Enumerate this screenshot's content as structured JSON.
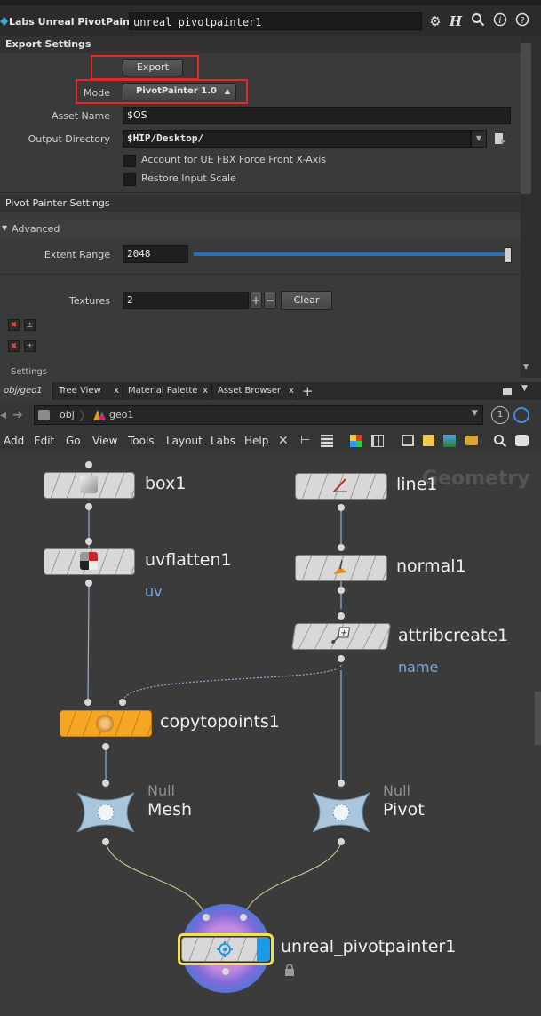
{
  "header": {
    "op_label": "Labs Unreal PivotPainter",
    "node_name": "unreal_pivotpainter1",
    "icons": [
      "gear-icon",
      "help-h-icon",
      "search-icon",
      "info-icon",
      "help-icon"
    ]
  },
  "export_settings": {
    "title": "Export Settings",
    "export_button": "Export",
    "mode_label": "Mode",
    "mode_value": "PivotPainter 1.0",
    "asset_name_label": "Asset Name",
    "asset_name_value": "$OS",
    "output_dir_label": "Output Directory",
    "output_dir_value": "$HIP/Desktop/",
    "checkbox_fbx": "Account for UE FBX Force Front X-Axis",
    "checkbox_scale": "Restore Input Scale"
  },
  "pivot_settings": {
    "title": "Pivot Painter Settings",
    "advanced": "Advanced",
    "extent_label": "Extent Range",
    "extent_value": "2048",
    "extent_fraction": 1.0,
    "textures_label": "Textures",
    "textures_value": "2",
    "plus": "+",
    "minus": "−",
    "clear_button": "Clear",
    "next_section": "Settings"
  },
  "tabs": [
    {
      "label": "obj/geo1"
    },
    {
      "label": "Tree View"
    },
    {
      "label": "Material Palette"
    },
    {
      "label": "Asset Browser"
    }
  ],
  "tab_close": "x",
  "tab_add": "+",
  "path": {
    "root": "obj",
    "current": "geo1",
    "badge": "1"
  },
  "menu": [
    "Add",
    "Edit",
    "Go",
    "View",
    "Tools",
    "Layout",
    "Labs",
    "Help"
  ],
  "network": {
    "context_label": "Geometry",
    "nodes": {
      "box": "box1",
      "uvflatten": "uvflatten1",
      "uvflatten_sub": "uv",
      "line": "line1",
      "normal": "normal1",
      "attribcreate": "attribcreate1",
      "attribcreate_sub": "name",
      "copytopoints": "copytopoints1",
      "null_type": "Null",
      "mesh": "Mesh",
      "pivot": "Pivot",
      "pivotpainter": "unreal_pivotpainter1"
    }
  },
  "colors": {
    "copytopoints": "#f5a623",
    "accent_blue": "#1a9be8",
    "highlight": "#e12a2a",
    "sub_text": "#79a7e3"
  }
}
